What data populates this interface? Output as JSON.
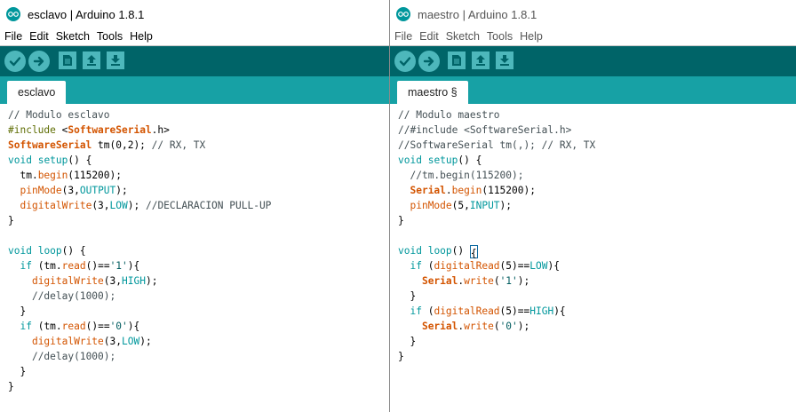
{
  "colors": {
    "toolbar_bg": "#006468",
    "tabbar_bg": "#17a1a5",
    "button_bg": "#4db7bb",
    "keyword": "#00979c",
    "function": "#d35400",
    "comment": "#434f54",
    "preprocessor": "#5e6d03",
    "string": "#005c5f"
  },
  "toolbar_icons": [
    "verify-icon",
    "upload-icon",
    "new-icon",
    "open-icon",
    "save-icon"
  ],
  "windows": {
    "left": {
      "title": "esclavo | Arduino 1.8.1",
      "menu": [
        "File",
        "Edit",
        "Sketch",
        "Tools",
        "Help"
      ],
      "tab": "esclavo",
      "code": [
        [
          [
            "cm",
            "// Modulo esclavo"
          ]
        ],
        [
          [
            "pp",
            "#include "
          ],
          [
            "",
            "<"
          ],
          [
            "cl",
            "SoftwareSerial"
          ],
          [
            "",
            ".h>"
          ]
        ],
        [
          [
            "cl",
            "SoftwareSerial"
          ],
          [
            "",
            " tm(0,2); "
          ],
          [
            "cm",
            "// RX, TX"
          ]
        ],
        [
          [
            "kw",
            "void"
          ],
          [
            "",
            " "
          ],
          [
            "kw",
            "setup"
          ],
          [
            "",
            "() {"
          ]
        ],
        [
          [
            "",
            "  tm."
          ],
          [
            "fn",
            "begin"
          ],
          [
            "",
            "(115200);"
          ]
        ],
        [
          [
            "",
            "  "
          ],
          [
            "fn",
            "pinMode"
          ],
          [
            "",
            "(3,"
          ],
          [
            "const",
            "OUTPUT"
          ],
          [
            "",
            ");"
          ]
        ],
        [
          [
            "",
            "  "
          ],
          [
            "fn",
            "digitalWrite"
          ],
          [
            "",
            "(3,"
          ],
          [
            "const",
            "LOW"
          ],
          [
            "",
            "); "
          ],
          [
            "cm",
            "//DECLARACION PULL-UP"
          ]
        ],
        [
          [
            "",
            "}"
          ]
        ],
        [
          [
            "",
            ""
          ]
        ],
        [
          [
            "kw",
            "void"
          ],
          [
            "",
            " "
          ],
          [
            "kw",
            "loop"
          ],
          [
            "",
            "() {"
          ]
        ],
        [
          [
            "",
            "  "
          ],
          [
            "kw",
            "if"
          ],
          [
            "",
            " (tm."
          ],
          [
            "fn",
            "read"
          ],
          [
            "",
            "()=="
          ],
          [
            "str",
            "'1'"
          ],
          [
            "",
            "){"
          ]
        ],
        [
          [
            "",
            "    "
          ],
          [
            "fn",
            "digitalWrite"
          ],
          [
            "",
            "(3,"
          ],
          [
            "const",
            "HIGH"
          ],
          [
            "",
            ");"
          ]
        ],
        [
          [
            "",
            "    "
          ],
          [
            "cm",
            "//delay(1000);"
          ]
        ],
        [
          [
            "",
            "  }"
          ]
        ],
        [
          [
            "",
            "  "
          ],
          [
            "kw",
            "if"
          ],
          [
            "",
            " (tm."
          ],
          [
            "fn",
            "read"
          ],
          [
            "",
            "()=="
          ],
          [
            "str",
            "'0'"
          ],
          [
            "",
            "){"
          ]
        ],
        [
          [
            "",
            "    "
          ],
          [
            "fn",
            "digitalWrite"
          ],
          [
            "",
            "(3,"
          ],
          [
            "const",
            "LOW"
          ],
          [
            "",
            ");"
          ]
        ],
        [
          [
            "",
            "    "
          ],
          [
            "cm",
            "//delay(1000);"
          ]
        ],
        [
          [
            "",
            "  }"
          ]
        ],
        [
          [
            "",
            "}"
          ]
        ]
      ]
    },
    "right": {
      "title": "maestro | Arduino 1.8.1",
      "menu": [
        "File",
        "Edit",
        "Sketch",
        "Tools",
        "Help"
      ],
      "tab": "maestro §",
      "code": [
        [
          [
            "cm",
            "// Modulo maestro"
          ]
        ],
        [
          [
            "cm",
            "//#include <SoftwareSerial.h>"
          ]
        ],
        [
          [
            "cm",
            "//SoftwareSerial tm(,); // RX, TX"
          ]
        ],
        [
          [
            "kw",
            "void"
          ],
          [
            "",
            " "
          ],
          [
            "kw",
            "setup"
          ],
          [
            "",
            "() {"
          ]
        ],
        [
          [
            "",
            "  "
          ],
          [
            "cm",
            "//tm.begin(115200);"
          ]
        ],
        [
          [
            "",
            "  "
          ],
          [
            "cl",
            "Serial"
          ],
          [
            "",
            "."
          ],
          [
            "fn",
            "begin"
          ],
          [
            "",
            "(115200);"
          ]
        ],
        [
          [
            "",
            "  "
          ],
          [
            "fn",
            "pinMode"
          ],
          [
            "",
            "(5,"
          ],
          [
            "const",
            "INPUT"
          ],
          [
            "",
            ");"
          ]
        ],
        [
          [
            "",
            "}"
          ]
        ],
        [
          [
            "",
            ""
          ]
        ],
        [
          [
            "kw",
            "void"
          ],
          [
            "",
            " "
          ],
          [
            "kw",
            "loop"
          ],
          [
            "",
            "() "
          ],
          [
            "caret",
            "{"
          ]
        ],
        [
          [
            "",
            "  "
          ],
          [
            "kw",
            "if"
          ],
          [
            "",
            " ("
          ],
          [
            "fn",
            "digitalRead"
          ],
          [
            "",
            "(5)=="
          ],
          [
            "const",
            "LOW"
          ],
          [
            "",
            "){"
          ]
        ],
        [
          [
            "",
            "    "
          ],
          [
            "cl",
            "Serial"
          ],
          [
            "",
            "."
          ],
          [
            "fn",
            "write"
          ],
          [
            "",
            "("
          ],
          [
            "str",
            "'1'"
          ],
          [
            "",
            ");"
          ]
        ],
        [
          [
            "",
            "  }"
          ]
        ],
        [
          [
            "",
            "  "
          ],
          [
            "kw",
            "if"
          ],
          [
            "",
            " ("
          ],
          [
            "fn",
            "digitalRead"
          ],
          [
            "",
            "(5)=="
          ],
          [
            "const",
            "HIGH"
          ],
          [
            "",
            "){"
          ]
        ],
        [
          [
            "",
            "    "
          ],
          [
            "cl",
            "Serial"
          ],
          [
            "",
            "."
          ],
          [
            "fn",
            "write"
          ],
          [
            "",
            "("
          ],
          [
            "str",
            "'0'"
          ],
          [
            "",
            ");"
          ]
        ],
        [
          [
            "",
            "  }"
          ]
        ],
        [
          [
            "",
            "}"
          ]
        ]
      ]
    }
  }
}
